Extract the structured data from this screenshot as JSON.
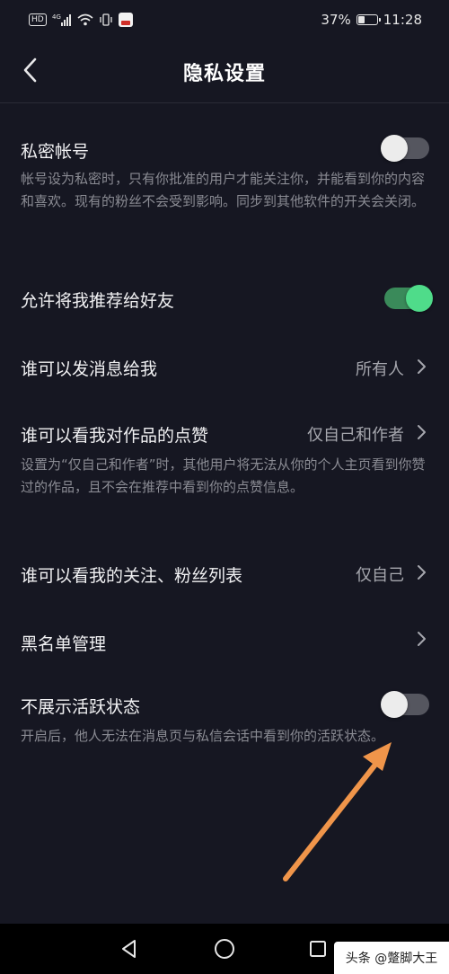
{
  "status_bar": {
    "hd_label": "HD",
    "network_label": "4G",
    "battery_text": "37%",
    "battery_level": 0.37,
    "time": "11:28"
  },
  "header": {
    "title": "隐私设置",
    "back_icon": "chevron-left-icon"
  },
  "settings": {
    "private_account": {
      "title": "私密帐号",
      "description": "帐号设为私密时，只有你批准的用户才能关注你，并能看到你的内容和喜欢。现有的粉丝不会受到影响。同步到其他软件的开关会关闭。",
      "enabled": false
    },
    "recommend_to_friends": {
      "title": "允许将我推荐给好友",
      "enabled": true
    },
    "who_can_message": {
      "title": "谁可以发消息给我",
      "value": "所有人"
    },
    "who_can_see_likes": {
      "title": "谁可以看我对作品的点赞",
      "value": "仅自己和作者",
      "description": "设置为“仅自己和作者”时，其他用户将无法从你的个人主页看到你赞过的作品，且不会在推荐中看到你的点赞信息。"
    },
    "who_can_see_follows": {
      "title": "谁可以看我的关注、粉丝列表",
      "value": "仅自己"
    },
    "blacklist": {
      "title": "黑名单管理"
    },
    "hide_active_status": {
      "title": "不展示活跃状态",
      "description": "开启后，他人无法在消息页与私信会话中看到你的活跃状态。",
      "enabled": false
    }
  },
  "colors": {
    "background": "#161722",
    "toggle_on": "#4fdc8a",
    "toggle_off": "#55565f",
    "annotation_arrow": "#f0954a"
  },
  "watermark": {
    "text": "头条 @蹩脚大王"
  }
}
